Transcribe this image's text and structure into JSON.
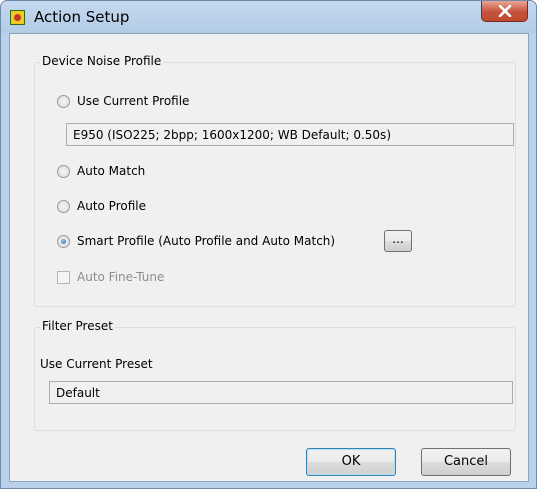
{
  "window": {
    "title": "Action Setup"
  },
  "noise_profile": {
    "legend": "Device Noise Profile",
    "options": [
      {
        "label": "Use Current Profile",
        "checked": false
      },
      {
        "label": "Auto Match",
        "checked": false
      },
      {
        "label": "Auto Profile",
        "checked": false
      },
      {
        "label": "Smart Profile (Auto Profile and Auto Match)",
        "checked": true
      }
    ],
    "current_profile_value": "E950 (ISO225; 2bpp; 1600x1200; WB Default; 0.50s)",
    "smart_profile_browse_label": "...",
    "fine_tune": {
      "label": "Auto Fine-Tune",
      "checked": false,
      "enabled": false
    }
  },
  "filter_preset": {
    "legend": "Filter Preset",
    "label": "Use Current Preset",
    "value": "Default"
  },
  "buttons": {
    "ok": "OK",
    "cancel": "Cancel"
  }
}
